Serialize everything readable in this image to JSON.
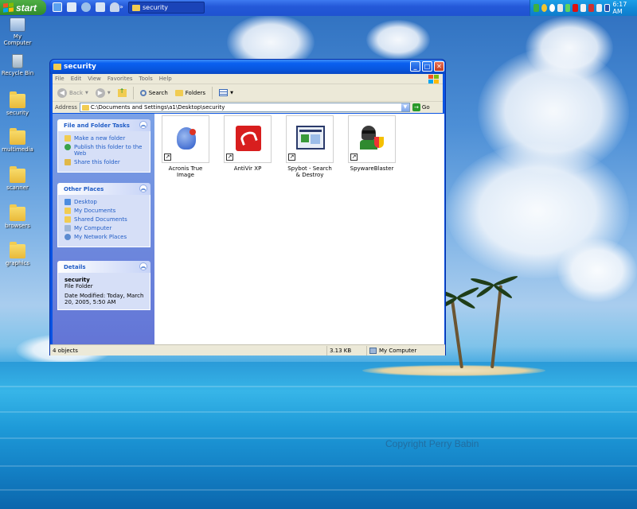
{
  "taskbar": {
    "start_label": "start",
    "task_label": "security",
    "clock": "6:17 AM"
  },
  "desktop_icons": [
    {
      "label": "My Computer",
      "icon": "my-computer-icon"
    },
    {
      "label": "Recycle Bin",
      "icon": "recycle-bin-icon"
    },
    {
      "label": "security",
      "icon": "folder-icon"
    },
    {
      "label": "multimedia",
      "icon": "folder-icon"
    },
    {
      "label": "scanner",
      "icon": "folder-icon"
    },
    {
      "label": "browsers",
      "icon": "folder-icon"
    },
    {
      "label": "graphics",
      "icon": "folder-icon"
    }
  ],
  "window": {
    "title": "security",
    "menu": [
      "File",
      "Edit",
      "View",
      "Favorites",
      "Tools",
      "Help"
    ],
    "toolbar": {
      "back": "Back",
      "search": "Search",
      "folders": "Folders"
    },
    "address": {
      "label": "Address",
      "value": "C:\\Documents and Settings\\a1\\Desktop\\security",
      "go": "Go"
    },
    "tasks_panel": {
      "title": "File and Folder Tasks",
      "links": [
        "Make a new folder",
        "Publish this folder to the Web",
        "Share this folder"
      ]
    },
    "places_panel": {
      "title": "Other Places",
      "links": [
        "Desktop",
        "My Documents",
        "Shared Documents",
        "My Computer",
        "My Network Places"
      ]
    },
    "details_panel": {
      "title": "Details",
      "name": "security",
      "type": "File Folder",
      "modified": "Date Modified: Today, March 20, 2005, 5:50 AM"
    },
    "files": [
      {
        "label": "Acronis True Image",
        "icon": "acronis-icon"
      },
      {
        "label": "AntiVir XP",
        "icon": "antivir-icon"
      },
      {
        "label": "Spybot - Search & Destroy",
        "icon": "spybot-icon"
      },
      {
        "label": "SpywareBlaster",
        "icon": "spywareblaster-icon"
      }
    ],
    "status": {
      "objects": "4 objects",
      "size": "3.13 KB",
      "location": "My Computer"
    }
  },
  "wallpaper": {
    "copyright": "Copyright Perry Babin"
  },
  "colors": {
    "taskbar": "#2459d8",
    "start_green": "#3c9a35",
    "title_blue": "#0855dd",
    "task_pane": "#6e8fe0",
    "link_blue": "#215dc6"
  }
}
